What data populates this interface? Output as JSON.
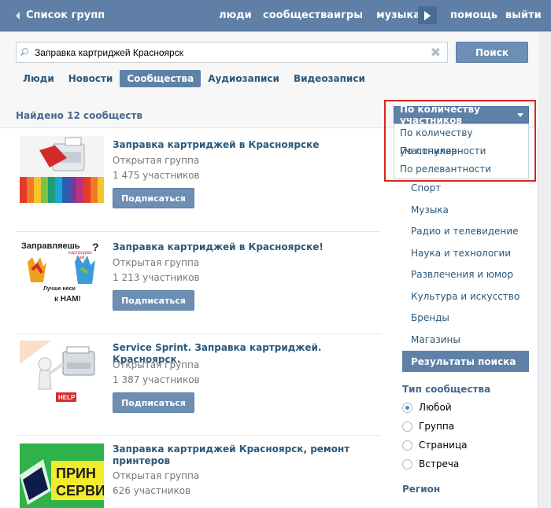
{
  "topbar": {
    "back_label": "Список групп",
    "nav": [
      "люди",
      "сообщества",
      "игры",
      "музыка",
      "помощь",
      "выйти"
    ]
  },
  "search": {
    "value": "Заправка картриджей Красноярск",
    "button": "Поиск"
  },
  "tabs": [
    "Люди",
    "Новости",
    "Сообщества",
    "Аудиозаписи",
    "Видеозаписи"
  ],
  "active_tab": "Сообщества",
  "results_summary": "Найдено 12 сообществ",
  "communities": [
    {
      "title": "Заправка картриджей в Красноярске",
      "type": "Открытая группа",
      "members": "1 475 участников",
      "button": "Подписаться"
    },
    {
      "title": "Заправка картриджей в Красноярске!",
      "type": "Открытая группа",
      "members": "1 213 участников",
      "button": "Подписаться",
      "image_text": [
        "Заправляешь",
        "картриджи",
        "сам",
        "?",
        "Лучше неси",
        "к НАМ!"
      ]
    },
    {
      "title": "Service Sprint. Заправка картриджей. Красноярск.",
      "type": "Открытая группа",
      "members": "1 387 участников",
      "button": "Подписаться",
      "image_text": [
        "HELP"
      ]
    },
    {
      "title": "Заправка картриджей Красноярск, ремонт принтеров",
      "type": "Открытая группа",
      "members": "626 участников",
      "button": "Подписаться",
      "image_text": [
        "ПРИН",
        "СЕРВИ"
      ]
    }
  ],
  "sort": {
    "selected": "По количеству участников",
    "options": [
      "По количеству участников",
      "По популярности",
      "По релевантности"
    ]
  },
  "categories": [
    "Спорт",
    "Музыка",
    "Радио и телевидение",
    "Наука и технологии",
    "Развлечения и юмор",
    "Культура и искусство",
    "Бренды",
    "Магазины"
  ],
  "results_button": "Результаты поиска",
  "community_type": {
    "label": "Тип сообщества",
    "options": [
      "Любой",
      "Группа",
      "Страница",
      "Встреча"
    ],
    "selected": "Любой"
  },
  "region_label": "Регион",
  "colors": {
    "topbar": "#5f7fa6",
    "accent": "#5e81a8",
    "link": "#2b587a",
    "highlight_box": "#d9251d"
  }
}
